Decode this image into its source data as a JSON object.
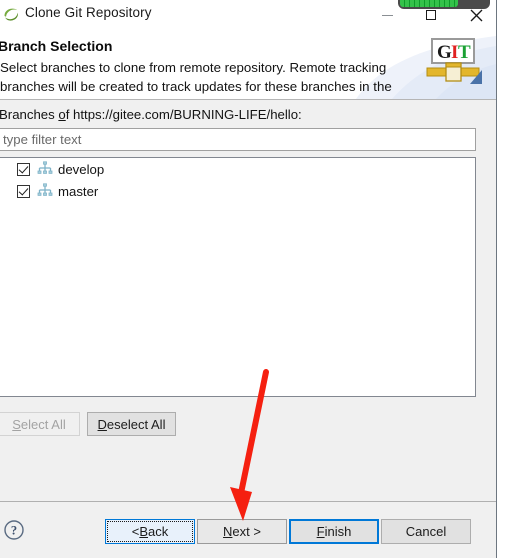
{
  "window": {
    "title": "Clone Git Repository",
    "icon": "eclipse-icon",
    "controls": {
      "minimize": "minimize-icon",
      "maximize": "maximize-icon",
      "close": "close-icon"
    }
  },
  "overlay": {
    "progress_widget": "green-progress-bar"
  },
  "banner": {
    "title": "Branch Selection",
    "description": "Select branches to clone from remote repository. Remote tracking branches will be created to track updates for these branches in the",
    "logo_letters": [
      "G",
      "I",
      "T"
    ],
    "logo_colors": {
      "g": "#1a1a1a",
      "i": "#e02020",
      "t": "#1aa033"
    }
  },
  "body": {
    "branches_label_prefix": "Branches ",
    "branches_label_mnemonic": "o",
    "branches_label_suffix": "f https://gitee.com/BURNING-LIFE/hello:",
    "repo_url": "https://gitee.com/BURNING-LIFE/hello",
    "filter": {
      "value": "",
      "placeholder": "type filter text"
    },
    "branches": [
      {
        "name": "develop",
        "checked": true,
        "icon": "branch-icon"
      },
      {
        "name": "master",
        "checked": true,
        "icon": "branch-icon"
      }
    ],
    "select_all": {
      "prefix": "S",
      "mnemonic": "S",
      "label_rest": "elect All",
      "full_label": "Select All",
      "enabled": false
    },
    "deselect_all": {
      "mnemonic": "D",
      "label_rest": "eselect All",
      "full_label": "Deselect All",
      "enabled": true
    }
  },
  "footer": {
    "help": "help-icon",
    "buttons": [
      {
        "id": "back",
        "pre": "< ",
        "mnemonic": "B",
        "post": "ack",
        "full_label": "< Back",
        "state": "focused"
      },
      {
        "id": "next",
        "pre": "",
        "mnemonic": "N",
        "post": "ext >",
        "full_label": "Next >",
        "state": "hover"
      },
      {
        "id": "finish",
        "pre": "",
        "mnemonic": "F",
        "post": "inish",
        "full_label": "Finish",
        "state": "default"
      },
      {
        "id": "cancel",
        "pre": "",
        "mnemonic": "",
        "post": "Cancel",
        "full_label": "Cancel",
        "state": "normal"
      }
    ]
  },
  "annotation": {
    "arrow": "red-down-arrow",
    "color": "#f52010"
  }
}
